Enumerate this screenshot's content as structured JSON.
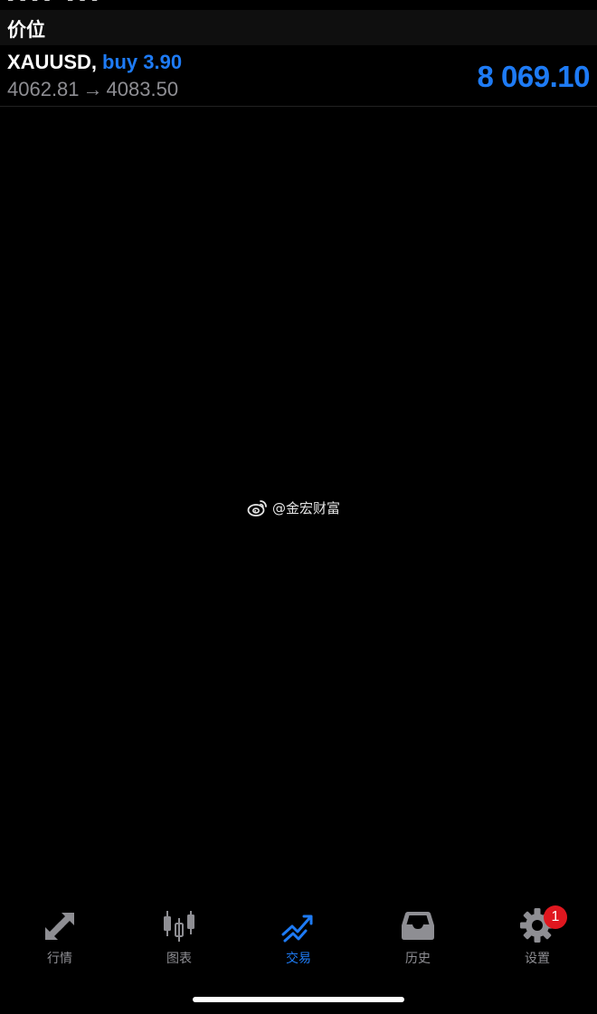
{
  "section": {
    "title": "价位"
  },
  "position": {
    "symbol": "XAUUSD,",
    "side": "buy 3.90",
    "open_price": "4062.81",
    "arrow": "→",
    "current_price": "4083.50",
    "profit": "8 069.10"
  },
  "watermark": {
    "text": "@金宏财富"
  },
  "tabs": [
    {
      "label": "行情",
      "icon": "quotes-arrows-icon"
    },
    {
      "label": "图表",
      "icon": "candlestick-chart-icon"
    },
    {
      "label": "交易",
      "icon": "trade-trend-icon"
    },
    {
      "label": "历史",
      "icon": "history-inbox-icon"
    },
    {
      "label": "设置",
      "icon": "gear-icon"
    }
  ],
  "badge": {
    "count": "1"
  },
  "colors": {
    "accent": "#1e7bf5",
    "inactive": "#8e8e93",
    "badge": "#e0171f",
    "background": "#000000"
  }
}
